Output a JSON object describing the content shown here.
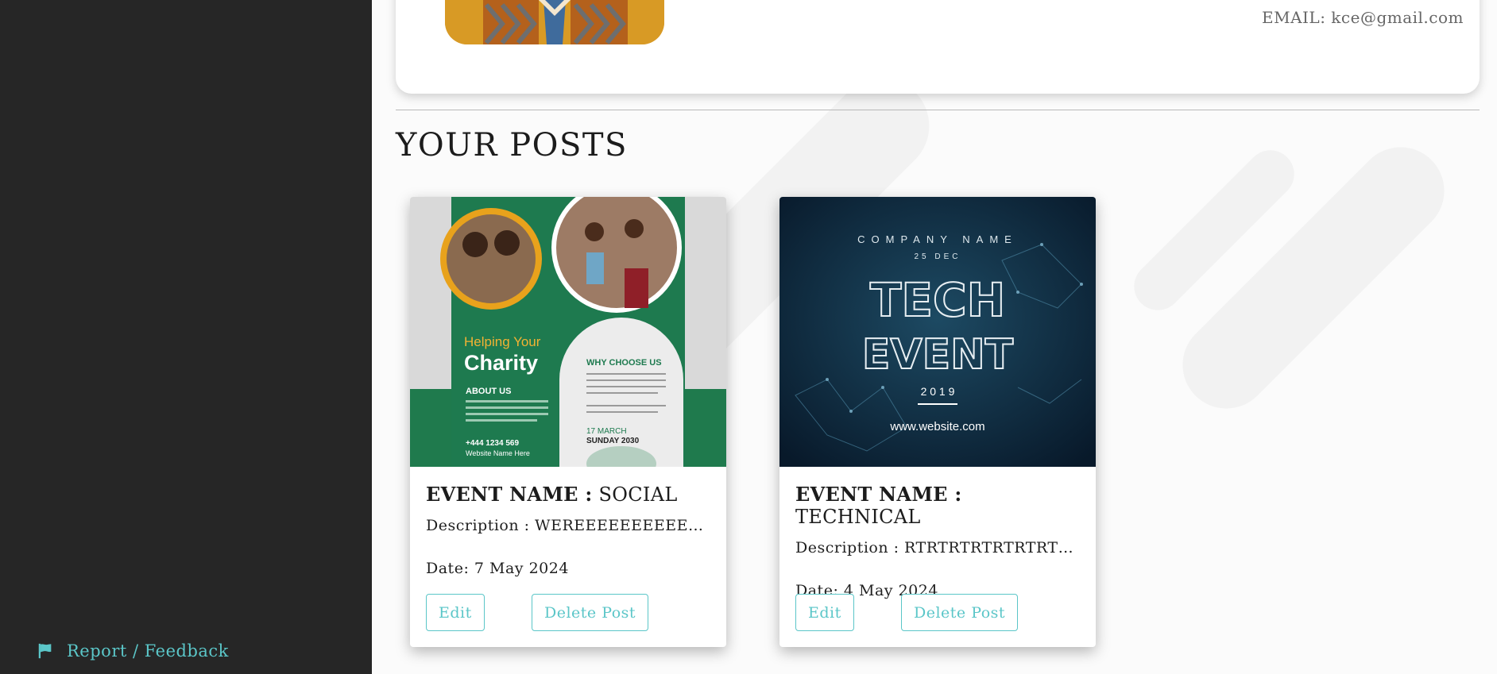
{
  "sidebar": {
    "report_label": "Report / Feedback",
    "report_icon": "flag-icon"
  },
  "profile": {
    "email": "EMAIL: kce@gmail.com"
  },
  "section": {
    "title": "YOUR POSTS"
  },
  "posts": [
    {
      "event_label": "EVENT NAME :",
      "event_name": "SOCIAL",
      "description": "Description : WEREEEEEEEEEEEEEEEEE",
      "date": "Date: 7 May 2024",
      "edit_label": "Edit",
      "delete_label": "Delete Post",
      "poster": {
        "heading_small": "Helping Your",
        "heading_big": "Charity",
        "about": "ABOUT US",
        "why": "WHY CHOOSE US",
        "date_line1": "17 MARCH",
        "date_line2": "SUNDAY 2030",
        "phone": "+444 1234 569",
        "website": "Website Name Here"
      }
    },
    {
      "event_label": "EVENT NAME :",
      "event_name": "TECHNICAL",
      "description": "Description : RTRTRTRTRTRTRTRTR",
      "date": "Date: 4 May 2024",
      "edit_label": "Edit",
      "delete_label": "Delete Post",
      "poster": {
        "company": "COMPANY NAME",
        "date": "25 DEC",
        "line1": "TECH",
        "line2": "EVENT",
        "year": "2 0 1 9",
        "website": "www.website.com"
      }
    }
  ],
  "colors": {
    "sidebar_bg": "#262626",
    "accent": "#5bc6c8"
  }
}
